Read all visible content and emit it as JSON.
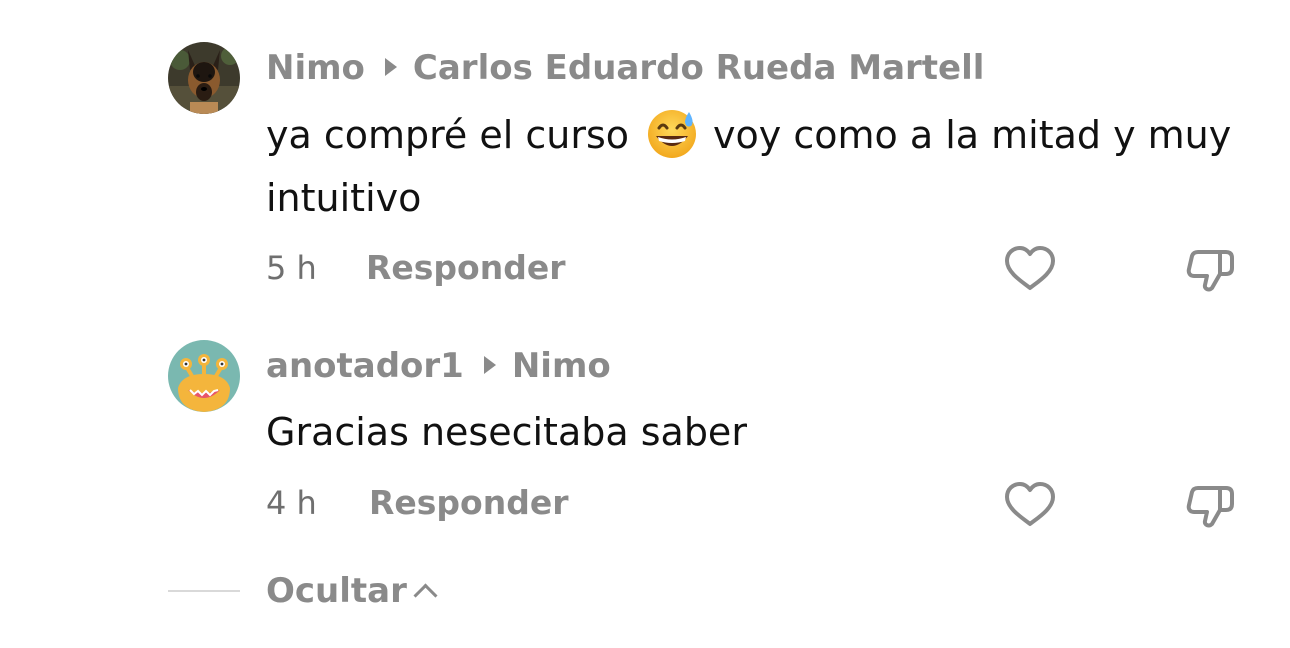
{
  "comments": [
    {
      "author": "Nimo",
      "reply_to": "Carlos Eduardo Rueda Martell",
      "text_before_emoji": "ya compré el curso",
      "emoji": "grinning-face-with-sweat",
      "text_after_emoji": "voy como a la mitad y muy intuitivo",
      "time": "5 h",
      "reply_label": "Responder",
      "avatar": "german-shepherd-dog-photo"
    },
    {
      "author": "anotador1",
      "reply_to": "Nimo",
      "text": "Gracias nesecitaba saber",
      "time": "4 h",
      "reply_label": "Responder",
      "avatar": "three-eyed-monster"
    }
  ],
  "hide_label": "Ocultar",
  "colors": {
    "meta_gray": "#8a8a8a",
    "time_gray": "#6f6f6f",
    "text": "#111111",
    "avatar2_bg": "#7ab8b0",
    "avatar2_monster": "#f4b53c"
  }
}
